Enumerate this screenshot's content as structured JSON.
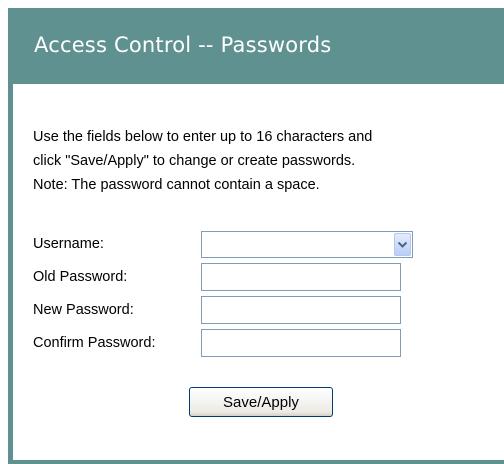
{
  "header": {
    "title": "Access Control -- Passwords"
  },
  "instructions": {
    "line1": "Use the fields below to enter up to 16 characters and",
    "line2": "click \"Save/Apply\" to change or create passwords.",
    "line3": "Note: The password cannot contain a space."
  },
  "form": {
    "username_label": "Username:",
    "username_value": "",
    "old_password_label": "Old Password:",
    "old_password_value": "",
    "new_password_label": "New Password:",
    "new_password_value": "",
    "confirm_password_label": "Confirm Password:",
    "confirm_password_value": "",
    "save_label": "Save/Apply"
  },
  "icons": {
    "dropdown": "chevron-down-icon"
  },
  "colors": {
    "header_background": "#5f9191",
    "header_text": "#ffffff",
    "panel_background": "#ffffff",
    "input_border": "#7f9db9"
  }
}
